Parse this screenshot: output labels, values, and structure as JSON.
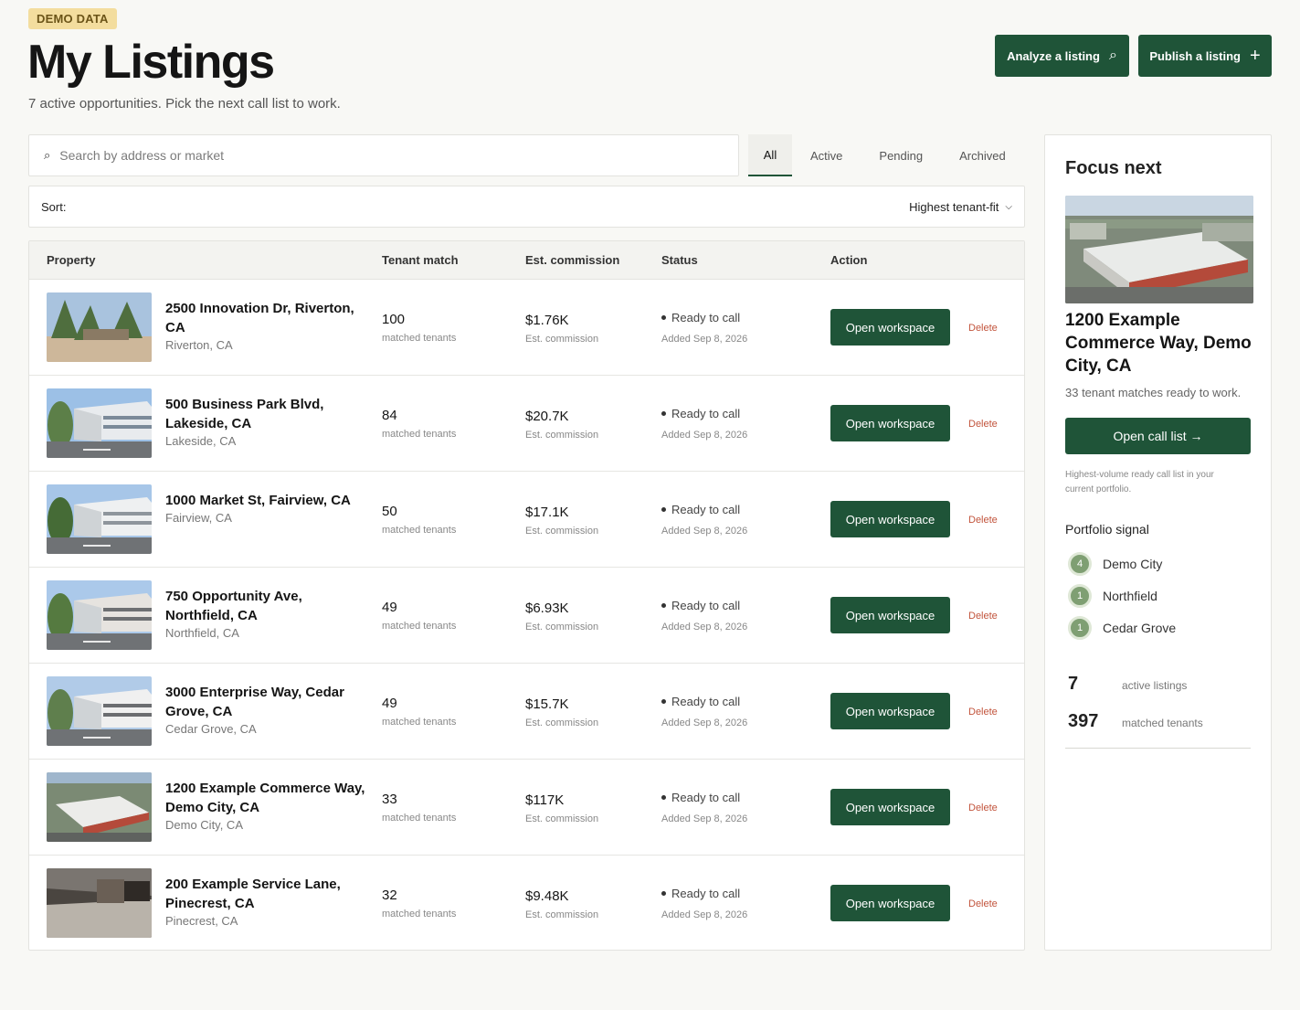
{
  "header": {
    "badge": "DEMO DATA",
    "title": "My Listings",
    "subtitle": "7 active opportunities. Pick the next call list to work.",
    "analyze_label": "Analyze a listing",
    "publish_label": "Publish a listing"
  },
  "search": {
    "placeholder": "Search by address or market",
    "value": ""
  },
  "tabs": [
    "All",
    "Active",
    "Pending",
    "Archived"
  ],
  "active_tab": "All",
  "sort": {
    "label": "Sort:",
    "value": "Highest tenant-fit"
  },
  "table": {
    "columns": [
      "Property",
      "Tenant match",
      "Est. commission",
      "Status",
      "Action"
    ],
    "rows": [
      {
        "name": "2500 Innovation Dr, Riverton, CA",
        "city": "Riverton, CA",
        "match": "100",
        "match_label": "matched tenants",
        "commission": "$1.76K",
        "commission_label": "Est. commission",
        "status": "Ready to call",
        "added": "Added Sep 8, 2026",
        "action": "Open workspace",
        "delete": "Delete"
      },
      {
        "name": "500 Business Park Blvd, Lakeside, CA",
        "city": "Lakeside, CA",
        "match": "84",
        "match_label": "matched tenants",
        "commission": "$20.7K",
        "commission_label": "Est. commission",
        "status": "Ready to call",
        "added": "Added Sep 8, 2026",
        "action": "Open workspace",
        "delete": "Delete"
      },
      {
        "name": "1000 Market St, Fairview, CA",
        "city": "Fairview, CA",
        "match": "50",
        "match_label": "matched tenants",
        "commission": "$17.1K",
        "commission_label": "Est. commission",
        "status": "Ready to call",
        "added": "Added Sep 8, 2026",
        "action": "Open workspace",
        "delete": "Delete"
      },
      {
        "name": "750 Opportunity Ave, Northfield, CA",
        "city": "Northfield, CA",
        "match": "49",
        "match_label": "matched tenants",
        "commission": "$6.93K",
        "commission_label": "Est. commission",
        "status": "Ready to call",
        "added": "Added Sep 8, 2026",
        "action": "Open workspace",
        "delete": "Delete"
      },
      {
        "name": "3000 Enterprise Way, Cedar Grove, CA",
        "city": "Cedar Grove, CA",
        "match": "49",
        "match_label": "matched tenants",
        "commission": "$15.7K",
        "commission_label": "Est. commission",
        "status": "Ready to call",
        "added": "Added Sep 8, 2026",
        "action": "Open workspace",
        "delete": "Delete"
      },
      {
        "name": "1200 Example Commerce Way, Demo City, CA",
        "city": "Demo City, CA",
        "match": "33",
        "match_label": "matched tenants",
        "commission": "$117K",
        "commission_label": "Est. commission",
        "status": "Ready to call",
        "added": "Added Sep 8, 2026",
        "action": "Open workspace",
        "delete": "Delete"
      },
      {
        "name": "200 Example Service Lane, Pinecrest, CA",
        "city": "Pinecrest, CA",
        "match": "32",
        "match_label": "matched tenants",
        "commission": "$9.48K",
        "commission_label": "Est. commission",
        "status": "Ready to call",
        "added": "Added Sep 8, 2026",
        "action": "Open workspace",
        "delete": "Delete"
      }
    ]
  },
  "focus": {
    "title": "Focus next",
    "name": "1200 Example Commerce Way, Demo City, CA",
    "matches": "33 tenant matches ready to work.",
    "button": "Open call list →",
    "hint": "Highest-volume ready call list in your current portfolio.",
    "signal_title": "Portfolio signal",
    "signals": [
      {
        "count": "4",
        "city": "Demo City"
      },
      {
        "count": "1",
        "city": "Northfield"
      },
      {
        "count": "1",
        "city": "Cedar Grove"
      }
    ],
    "stats": [
      {
        "value": "7",
        "label": "active listings"
      },
      {
        "value": "397",
        "label": "matched tenants"
      }
    ]
  },
  "colors": {
    "accent": "#1f5438",
    "delete": "#c2543c",
    "badge": "#f3dd9e",
    "signal": "#7f9f73"
  }
}
